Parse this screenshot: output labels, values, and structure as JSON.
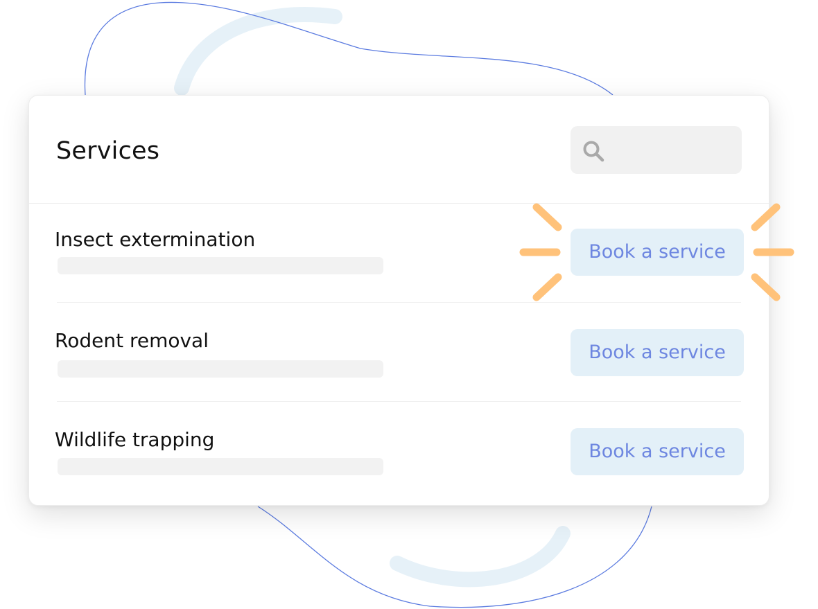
{
  "page": {
    "title": "Services"
  },
  "search": {
    "placeholder": "",
    "value": "",
    "icon": "search-icon"
  },
  "services": [
    {
      "name": "Insect extermination",
      "button_label": "Book a service",
      "highlighted": true
    },
    {
      "name": "Rodent removal",
      "button_label": "Book a service",
      "highlighted": false
    },
    {
      "name": "Wildlife trapping",
      "button_label": "Book a service",
      "highlighted": false
    }
  ],
  "colors": {
    "accent_text": "#6d86e0",
    "button_bg": "#e3f0f8",
    "sparkle": "#ffc27a",
    "decor_line": "#5b7be0",
    "decor_arc": "#e6f1f8"
  }
}
